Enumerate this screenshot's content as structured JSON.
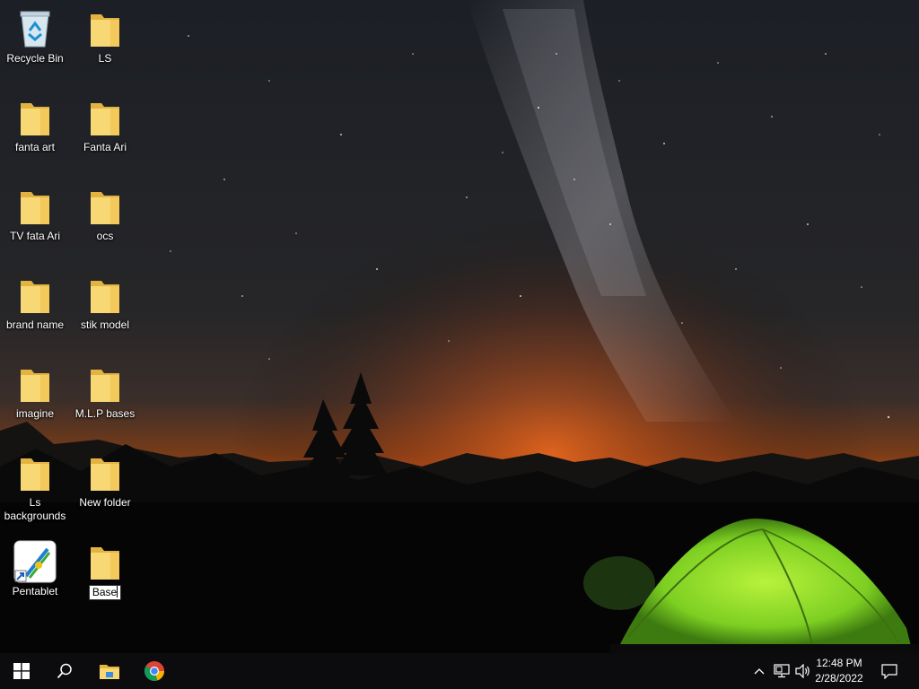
{
  "desktop": {
    "icons": [
      {
        "label": "Recycle Bin",
        "icon": "recycle-bin-icon"
      },
      {
        "label": "LS",
        "icon": "folder-icon"
      },
      {
        "label": "fanta art",
        "icon": "folder-icon"
      },
      {
        "label": "Fanta Ari",
        "icon": "folder-icon"
      },
      {
        "label": "TV  fata Ari",
        "icon": "folder-icon"
      },
      {
        "label": "ocs",
        "icon": "folder-icon"
      },
      {
        "label": "brand name",
        "icon": "folder-icon"
      },
      {
        "label": "stik  model",
        "icon": "folder-icon"
      },
      {
        "label": "imagine",
        "icon": "folder-icon"
      },
      {
        "label": "M.L.P bases",
        "icon": "folder-icon"
      },
      {
        "label": "Ls backgrounds",
        "icon": "folder-icon"
      },
      {
        "label": "New folder",
        "icon": "folder-icon"
      },
      {
        "label": "Pentablet",
        "icon": "pentablet-app-icon"
      },
      {
        "label": "Base",
        "icon": "folder-icon",
        "renaming": true
      }
    ]
  },
  "taskbar": {
    "pinned": [
      {
        "name": "start",
        "icon": "windows-logo-icon"
      },
      {
        "name": "search",
        "icon": "search-icon"
      },
      {
        "name": "file-explorer",
        "icon": "file-explorer-icon"
      },
      {
        "name": "chrome",
        "icon": "chrome-icon"
      }
    ],
    "tray": {
      "icons": [
        "chevron-up-icon",
        "network-icon",
        "volume-icon"
      ],
      "time": "12:48 PM",
      "date": "2/28/2022",
      "notification_icon": "action-center-icon"
    }
  },
  "colors": {
    "taskbar_bg": "#0c0c0e",
    "folder_yellow": "#f8d775",
    "tent_green": "#8fe02c",
    "horizon_orange": "#e0621c"
  }
}
